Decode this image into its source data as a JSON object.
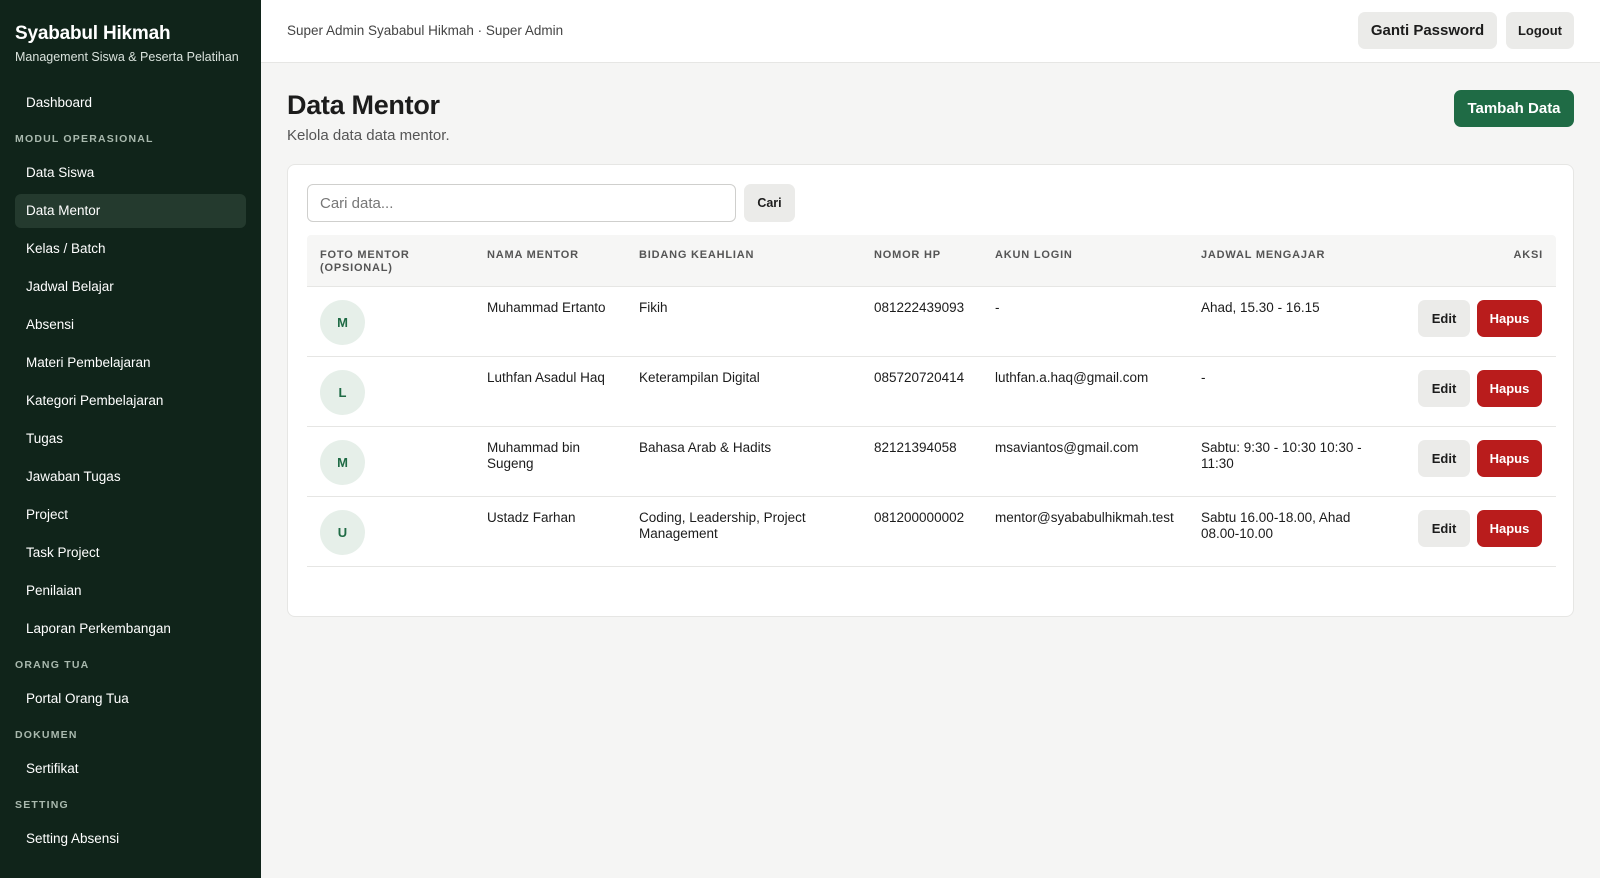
{
  "brand": {
    "title": "Syababul Hikmah",
    "subtitle": "Management Siswa & Peserta Pelatihan"
  },
  "sidebar": {
    "dashboard": "Dashboard",
    "sections": [
      {
        "label": "MODUL OPERASIONAL",
        "items": [
          "Data Siswa",
          "Data Mentor",
          "Kelas / Batch",
          "Jadwal Belajar",
          "Absensi",
          "Materi Pembelajaran",
          "Kategori Pembelajaran",
          "Tugas",
          "Jawaban Tugas",
          "Project",
          "Task Project",
          "Penilaian",
          "Laporan Perkembangan"
        ]
      },
      {
        "label": "ORANG TUA",
        "items": [
          "Portal Orang Tua"
        ]
      },
      {
        "label": "DOKUMEN",
        "items": [
          "Sertifikat"
        ]
      },
      {
        "label": "SETTING",
        "items": [
          "Setting Absensi"
        ]
      }
    ],
    "active": "Data Mentor"
  },
  "topbar": {
    "user": "Super Admin Syababul Hikmah · Super Admin",
    "change_password": "Ganti Password",
    "logout": "Logout"
  },
  "page": {
    "title": "Data Mentor",
    "subtitle": "Kelola data data mentor.",
    "add_button": "Tambah Data"
  },
  "search": {
    "placeholder": "Cari data...",
    "button": "Cari"
  },
  "table": {
    "headers": [
      "FOTO MENTOR (OPSIONAL)",
      "NAMA MENTOR",
      "BIDANG KEAHLIAN",
      "NOMOR HP",
      "AKUN LOGIN",
      "JADWAL MENGAJAR",
      "AKSI"
    ],
    "edit_label": "Edit",
    "delete_label": "Hapus",
    "rows": [
      {
        "initial": "M",
        "name": "Muhammad Ertanto",
        "skill": "Fikih",
        "phone": "081222439093",
        "account": "-",
        "schedule": "Ahad, 15.30 - 16.15"
      },
      {
        "initial": "L",
        "name": "Luthfan Asadul Haq",
        "skill": "Keterampilan Digital",
        "phone": "085720720414",
        "account": "luthfan.a.haq@gmail.com",
        "schedule": "-"
      },
      {
        "initial": "M",
        "name": "Muhammad bin Sugeng",
        "skill": "Bahasa Arab & Hadits",
        "phone": "82121394058",
        "account": "msaviantos@gmail.com",
        "schedule": "Sabtu: 9:30 - 10:30 10:30 - 11:30"
      },
      {
        "initial": "U",
        "name": "Ustadz Farhan",
        "skill": "Coding, Leadership, Project Management",
        "phone": "081200000002",
        "account": "mentor@syababulhikmah.test",
        "schedule": "Sabtu 16.00-18.00, Ahad 08.00-10.00"
      }
    ]
  },
  "colors": {
    "sidebar_bg": "#10241a",
    "accent": "#1f6b45",
    "danger": "#b91c1c"
  }
}
